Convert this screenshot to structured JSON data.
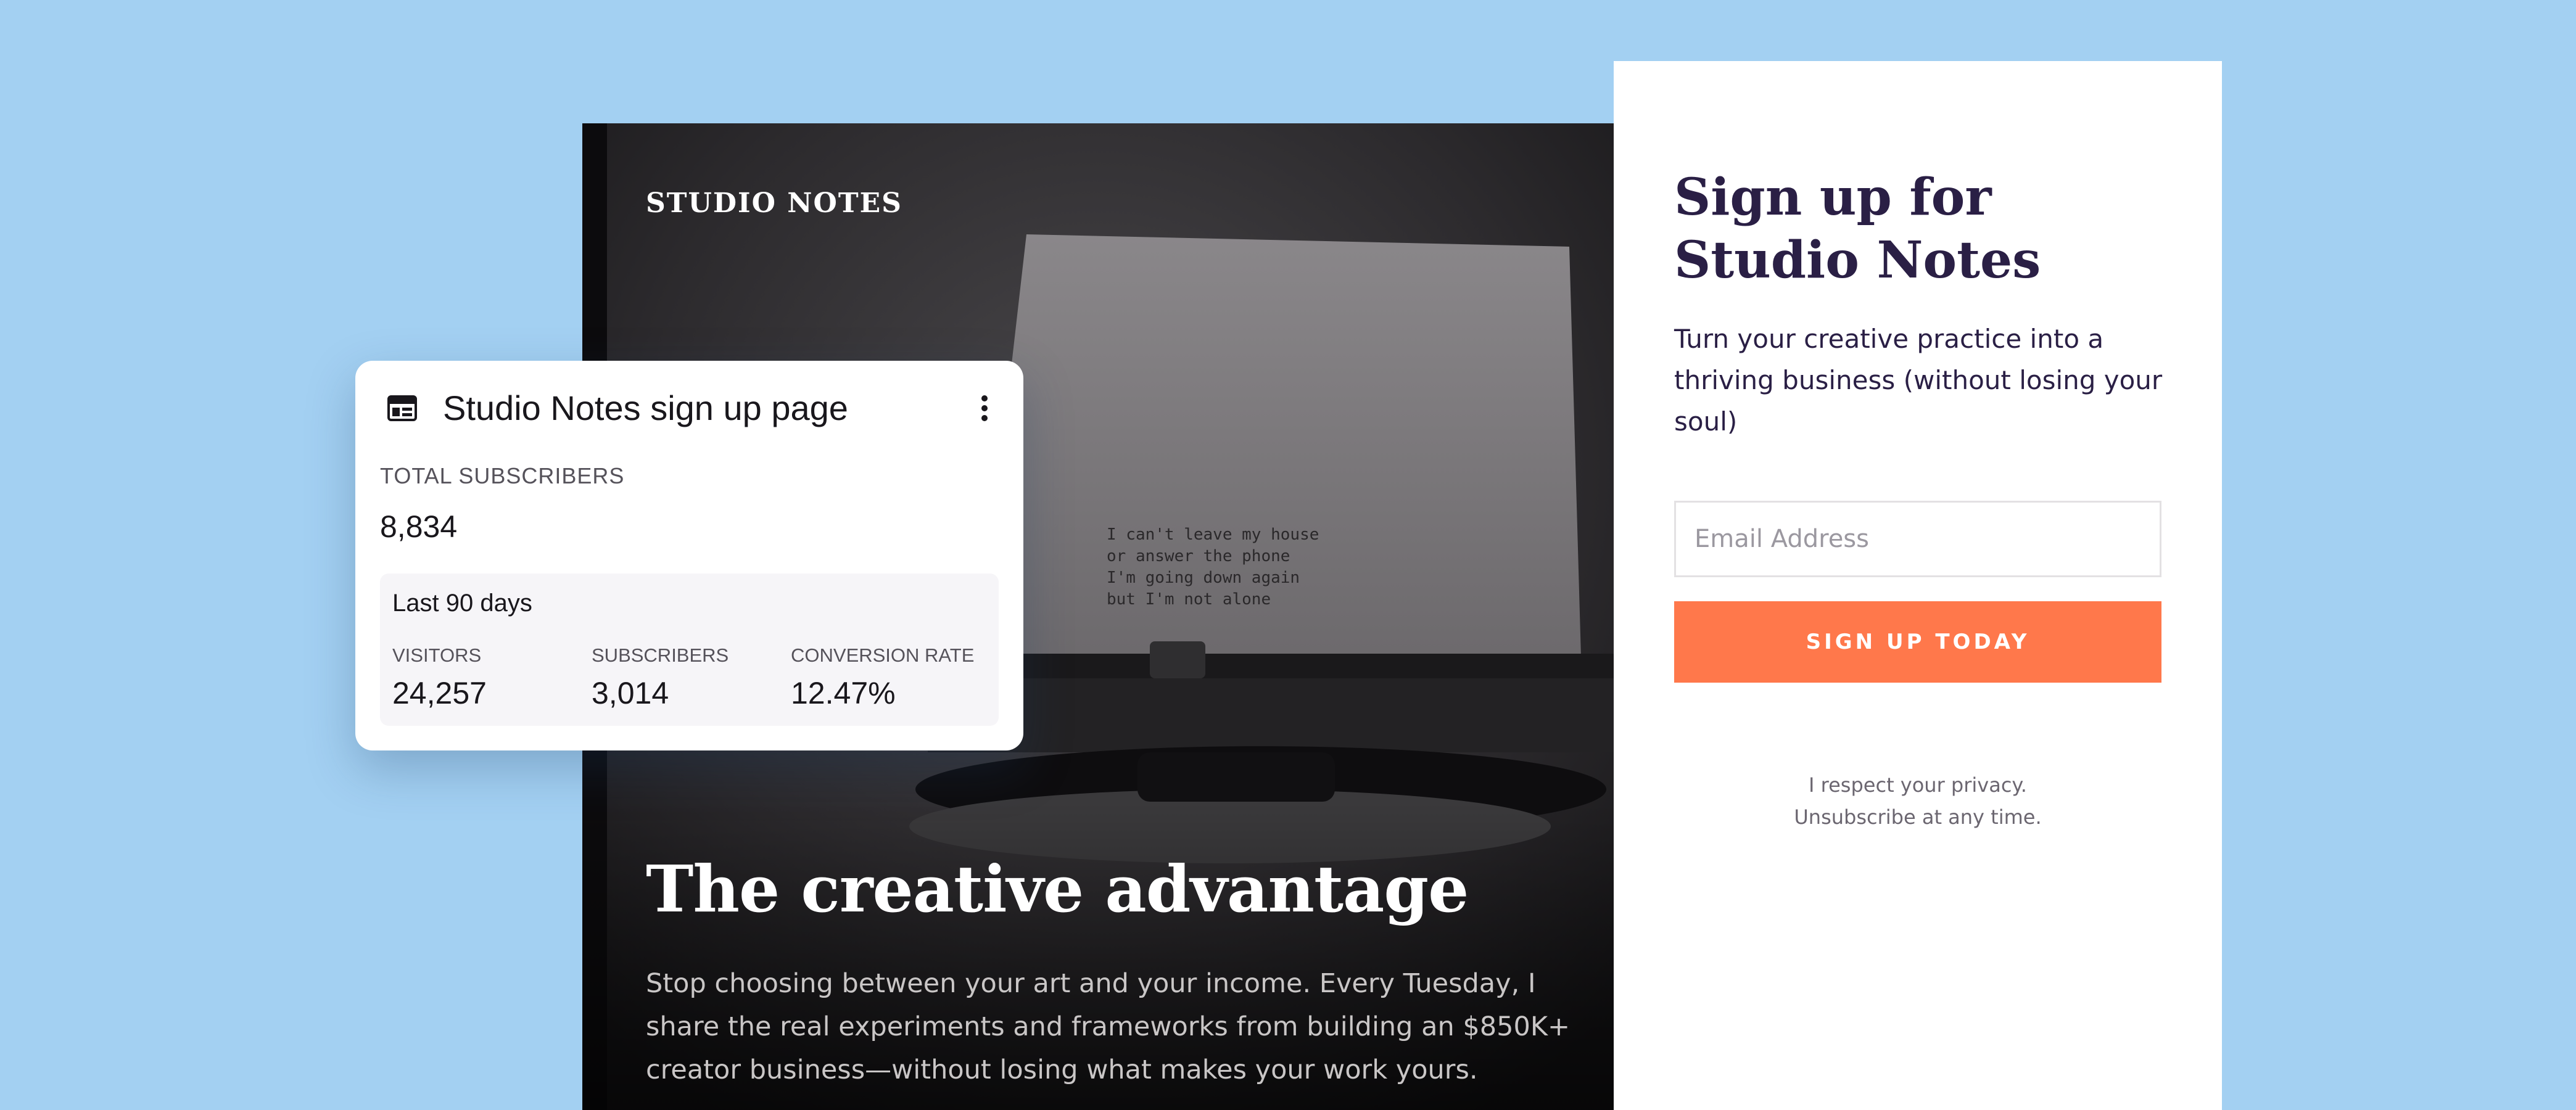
{
  "hero": {
    "brand": "STUDIO NOTES",
    "title": "The creative advantage",
    "body": "Stop choosing between your art and your income. Every Tuesday, I share the real experiments and frameworks from building an $850K+ creator business—without losing what makes your work yours.",
    "typewriter_lines": [
      "I can't leave my house",
      "or answer the phone",
      "I'm going down again",
      "but I'm not alone"
    ]
  },
  "signup": {
    "title": "Sign up for Studio Notes",
    "description": "Turn your creative practice into a thriving business (without losing your soul)",
    "email_placeholder": "Email Address",
    "button_label": "SIGN UP TODAY",
    "privacy_line1": "I respect your privacy.",
    "privacy_line2": "Unsubscribe at any time."
  },
  "widget": {
    "icon": "page-layout-icon",
    "title": "Studio Notes sign up page",
    "total_label": "TOTAL SUBSCRIBERS",
    "total_value": "8,834",
    "period": "Last 90 days",
    "stats": [
      {
        "label": "VISITORS",
        "value": "24,257"
      },
      {
        "label": "SUBSCRIBERS",
        "value": "3,014"
      },
      {
        "label": "CONVERSION RATE",
        "value": "12.47%"
      }
    ]
  },
  "colors": {
    "background": "#a3d0f2",
    "accent": "#ff784b",
    "heading": "#2a1f45"
  }
}
